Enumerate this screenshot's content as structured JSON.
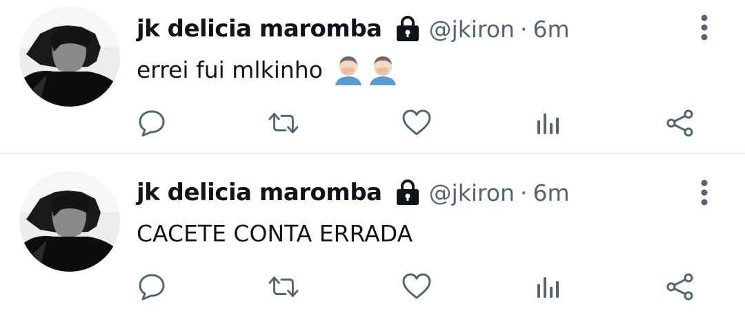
{
  "tweets": [
    {
      "display_name": "jk delicia maromba",
      "handle": "@jkiron",
      "separator": "·",
      "time": "6m",
      "text": "errei fui mlkinho",
      "emojis": [
        "man-facepalming-icon",
        "man-facepalming-icon"
      ],
      "protected": true
    },
    {
      "display_name": "jk delicia maromba",
      "handle": "@jkiron",
      "separator": "·",
      "time": "6m",
      "text": "CACETE CONTA ERRADA",
      "emojis": [],
      "protected": true
    }
  ],
  "actions": [
    "reply-icon",
    "retweet-icon",
    "like-icon",
    "analytics-icon",
    "share-icon"
  ],
  "colors": {
    "icon_gray": "#536471",
    "text": "#0f1419",
    "divider": "#e8ebed"
  }
}
